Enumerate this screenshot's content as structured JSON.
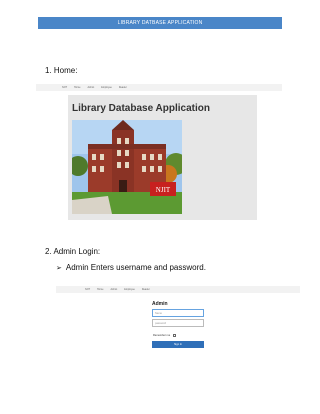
{
  "doc": {
    "title": "LIBRARY DATBASE APPLICATION",
    "section1": "1.  Home:",
    "section2": "2.  Admin Login:",
    "bullet": "Admin Enters username and password."
  },
  "home_nav": {
    "items": [
      "NJIT",
      "Home",
      "Admin",
      "Employee",
      "Reader"
    ]
  },
  "hero": {
    "title": "Library Database Application",
    "sign": "NJIT"
  },
  "login_nav": {
    "items": [
      "NJIT",
      "Home",
      "Admin",
      "Employee",
      "Reader"
    ]
  },
  "login": {
    "title": "Admin",
    "username_placeholder": "Name",
    "password_placeholder": "password",
    "remember_label": "Remember me",
    "signin_label": "Sign In"
  },
  "colors": {
    "title_bar": "#4a86c8",
    "signin": "#2f6fb8"
  }
}
